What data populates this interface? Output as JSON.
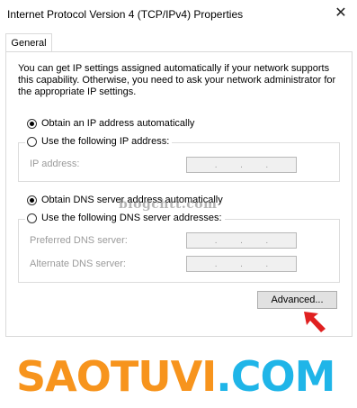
{
  "window": {
    "title": "Internet Protocol Version 4 (TCP/IPv4) Properties",
    "close_glyph": "✕"
  },
  "tabs": [
    {
      "label": "General"
    }
  ],
  "description": "You can get IP settings assigned automatically if your network supports this capability. Otherwise, you need to ask your network administrator for the appropriate IP settings.",
  "ip_section": {
    "auto_label": "Obtain an IP address automatically",
    "manual_label": "Use the following IP address:",
    "selected": "auto",
    "fields": [
      {
        "label": "IP address:",
        "value": ". . ."
      }
    ]
  },
  "dns_section": {
    "auto_label": "Obtain DNS server address automatically",
    "manual_label": "Use the following DNS server addresses:",
    "selected": "auto",
    "fields": [
      {
        "label": "Preferred DNS server:",
        "value": ". . ."
      },
      {
        "label": "Alternate DNS server:",
        "value": ". . ."
      }
    ]
  },
  "buttons": {
    "advanced_label": "Advanced..."
  },
  "watermarks": {
    "overlay": "blogchtt.com",
    "brand_part1": "SAOTUVI",
    "brand_part2": ".COM"
  },
  "colors": {
    "brand_orange": "#f7941d",
    "brand_blue": "#1fb5e8",
    "arrow_red": "#e02020"
  },
  "icons": {
    "close": "close-icon",
    "pointer": "red-arrow-icon"
  }
}
